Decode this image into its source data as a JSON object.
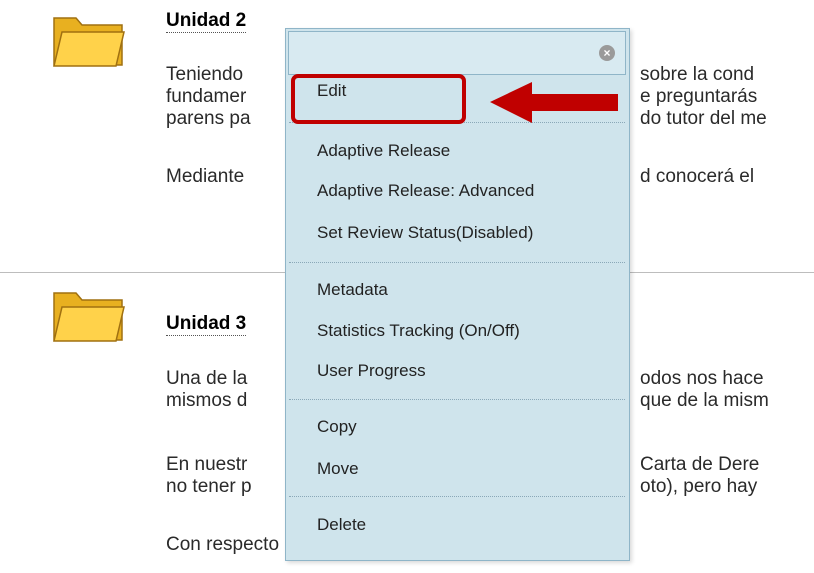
{
  "units": [
    {
      "title": "Unidad 2",
      "paragraphs": [
        {
          "left": "Teniendo",
          "right": "sobre la cond"
        },
        {
          "left": "fundamer",
          "right": "e preguntarás"
        },
        {
          "left": "parens pa",
          "right": "do tutor del me"
        },
        {
          "left": "Mediante",
          "right": "d conocerá el"
        }
      ]
    },
    {
      "title": "Unidad 3",
      "paragraphs": [
        {
          "left": "Una  de la",
          "right": "odos nos hace"
        },
        {
          "left": "mismos d",
          "right": "que de la mism"
        },
        {
          "left": "En nuestr",
          "right": "Carta de Dere"
        },
        {
          "left": "no tener p",
          "right": "oto), pero hay"
        },
        {
          "left": "Con respecto a la renuncia de jurisdicción, la Ley c",
          "right": ""
        }
      ]
    }
  ],
  "menu": {
    "items": [
      "Edit",
      "Adaptive Release",
      "Adaptive Release: Advanced",
      "Set Review Status(Disabled)",
      "Metadata",
      "Statistics Tracking (On/Off)",
      "User Progress",
      "Copy",
      "Move",
      "Delete"
    ],
    "close_icon": "close-circle-icon"
  },
  "annotation": {
    "highlight_color": "#c00000",
    "arrow_color": "#c00000"
  }
}
